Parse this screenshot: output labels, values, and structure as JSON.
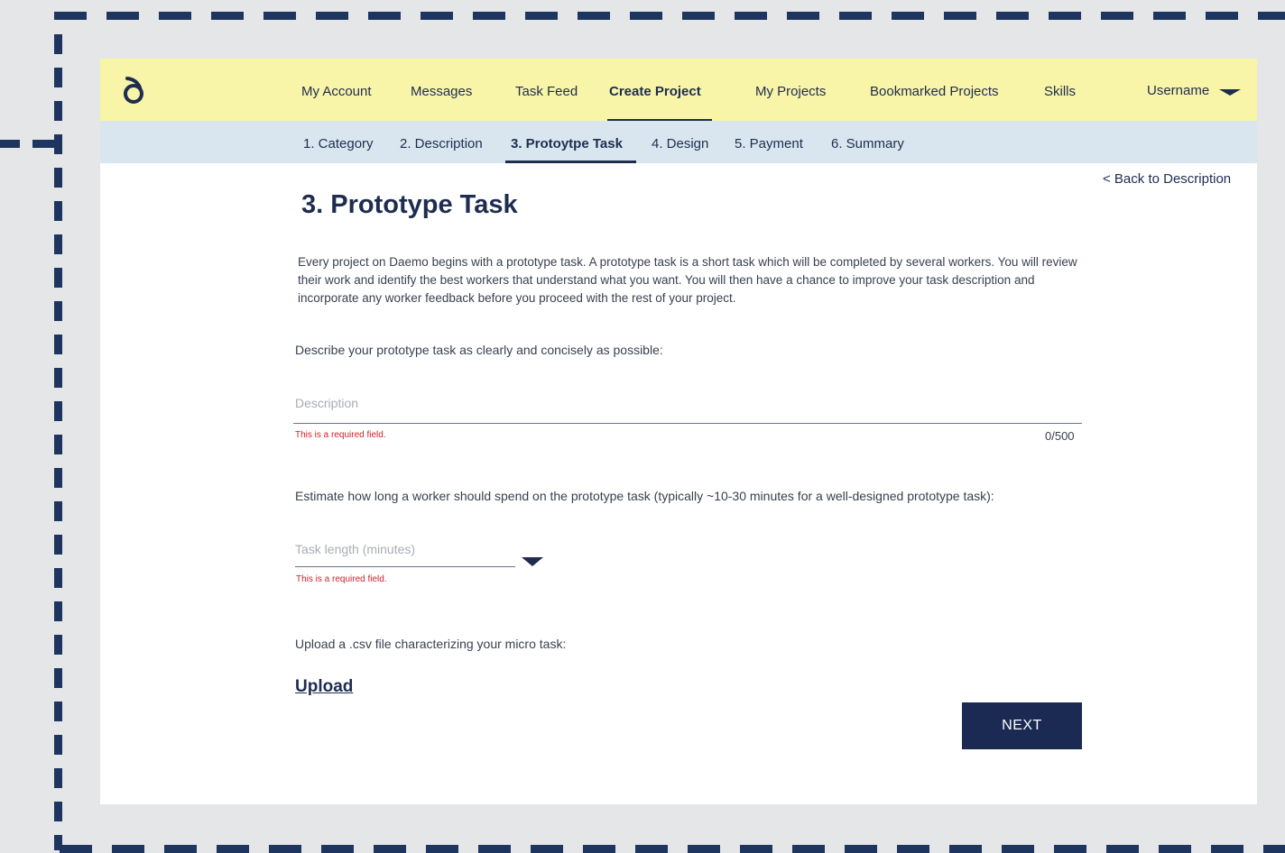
{
  "colors": {
    "navy": "#1e2d4f",
    "topnav_bg": "#f8f4a8",
    "stepnav_bg": "#d9e6ef",
    "error": "#d0202c",
    "button_bg": "#1b2a52",
    "backdrop": "#e4e6e8"
  },
  "topnav": {
    "logo_icon": "daemo-logo-icon",
    "items": [
      {
        "label": "My Account"
      },
      {
        "label": "Messages"
      },
      {
        "label": "Task Feed"
      },
      {
        "label": "Create Project",
        "active": true
      },
      {
        "label": "My Projects"
      },
      {
        "label": "Bookmarked Projects"
      },
      {
        "label": "Skills"
      }
    ],
    "user": {
      "label": "Username",
      "icon": "caret-down-icon"
    }
  },
  "steps": {
    "items": [
      {
        "label": "1. Category"
      },
      {
        "label": "2. Description"
      },
      {
        "label": "3. Protoytpe Task",
        "active": true
      },
      {
        "label": "4. Design"
      },
      {
        "label": "5. Payment"
      },
      {
        "label": "6. Summary"
      }
    ]
  },
  "main": {
    "back_link": "< Back to Description",
    "title": "3. Prototype Task",
    "intro": "Every project on Daemo begins with a prototype task. A prototype task is a short task which will be completed by several workers. You will review their work and identify the best workers that understand what you want. You will then have a chance to improve your task description and incorporate any worker feedback before you proceed with the rest of your project.",
    "description_prompt": "Describe your prototype task as clearly and concisely as possible:",
    "description_field": {
      "placeholder": "Description",
      "value": "",
      "error": "This is a required field.",
      "counter": "0/500"
    },
    "length_prompt": "Estimate how long a worker should spend on the prototype task (typically ~10-30 minutes for a well-designed prototype task):",
    "length_field": {
      "placeholder": "Task length (minutes)",
      "value": "",
      "error": "This is a required field.",
      "icon": "caret-down-icon"
    },
    "upload_prompt": "Upload a .csv file characterizing your micro task:",
    "upload_label": "Upload",
    "next_label": "NEXT"
  }
}
